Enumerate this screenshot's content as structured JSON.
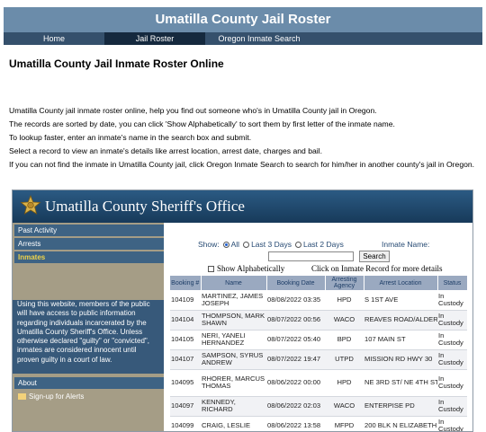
{
  "site": {
    "header_title": "Umatilla County Jail Roster",
    "nav": [
      {
        "label": "Home"
      },
      {
        "label": "Jail Roster"
      },
      {
        "label": "Oregon Inmate Search"
      }
    ]
  },
  "page": {
    "title": "Umatilla County Jail Inmate Roster Online",
    "intro": [
      "Umatilla County jail inmate roster online, help you find out someone who's in Umatilla County jail in Oregon.",
      "The records are sorted by date, you can click 'Show Alphabetically' to sort them by first letter of the inmate name.",
      "To lookup faster, enter an inmate's name in the search box and submit.",
      "Select a record to view an inmate's details like arrest location, arrest date, charges and bail.",
      "If you can not find the inmate in Umatilla County jail, click Oregon Inmate Search to search for him/her in another county's jail in Oregon."
    ]
  },
  "embed": {
    "title": "Umatilla County Sheriff's Office",
    "sidebar": {
      "links": [
        "Past Activity",
        "Arrests",
        "Inmates"
      ],
      "note": "Using this website, members of the public will have access to public information regarding individuals incarcerated by the Umatilla County Sheriff's Office. Unless otherwise declared \"guilty\" or \"convicted\", inmates are considered innocent until proven guilty in a court of law.",
      "about": "About",
      "alerts": "Sign-up for Alerts"
    },
    "search": {
      "show_label": "Show:",
      "options": [
        "All",
        "Last 3 Days",
        "Last 2 Days"
      ],
      "inmate_name_label": "Inmate Name:",
      "input_value": "",
      "button": "Search",
      "alpha_label": "Show Alphabetically",
      "click_note": "Click on Inmate Record for more details"
    },
    "table": {
      "columns": [
        "Booking #",
        "Name",
        "Booking Date",
        "Arresting Agency",
        "Arrest Location",
        "Status"
      ],
      "rows": [
        {
          "booking": "104109",
          "name": "MARTINEZ, JAMES JOSEPH",
          "date": "08/08/2022 03:35",
          "agency": "HPD",
          "location": "S 1ST AVE",
          "status": "In Custody"
        },
        {
          "booking": "104104",
          "name": "THOMPSON, MARK SHAWN",
          "date": "08/07/2022 00:56",
          "agency": "WACO",
          "location": "REAVES ROAD/ALDER",
          "status": "In Custody"
        },
        {
          "booking": "104105",
          "name": "NERI, YANELI HERNANDEZ",
          "date": "08/07/2022 05:40",
          "agency": "BPD",
          "location": "107 MAIN ST",
          "status": "In Custody"
        },
        {
          "booking": "104107",
          "name": "SAMPSON, SYRUS ANDREW",
          "date": "08/07/2022 19:47",
          "agency": "UTPD",
          "location": "MISSION RD HWY 30",
          "status": "In Custody"
        },
        {
          "booking": "104095",
          "name": "RHORER, MARCUS THOMAS",
          "date": "08/06/2022 00:00",
          "agency": "HPD",
          "location": "NE 3RD ST/ NE 4TH ST",
          "status": "In Custody"
        },
        {
          "booking": "104097",
          "name": "KENNEDY, RICHARD",
          "date": "08/06/2022 02:03",
          "agency": "WACO",
          "location": "ENTERPISE PD",
          "status": "In Custody"
        },
        {
          "booking": "104099",
          "name": "CRAIG, LESLIE",
          "date": "08/06/2022 13:58",
          "agency": "MFPD",
          "location": "200 BLK N ELIZABETH",
          "status": "In Custody"
        }
      ]
    }
  },
  "colors": {
    "header_bg": "#6b8caa",
    "nav_bg": "#35506c",
    "nav_active": "#15293e",
    "embed_header": "#1f4a6e",
    "sidebar_bg": "#a59d86",
    "sidebar_link": "#3e6384",
    "active_link": "#f0d44a"
  }
}
